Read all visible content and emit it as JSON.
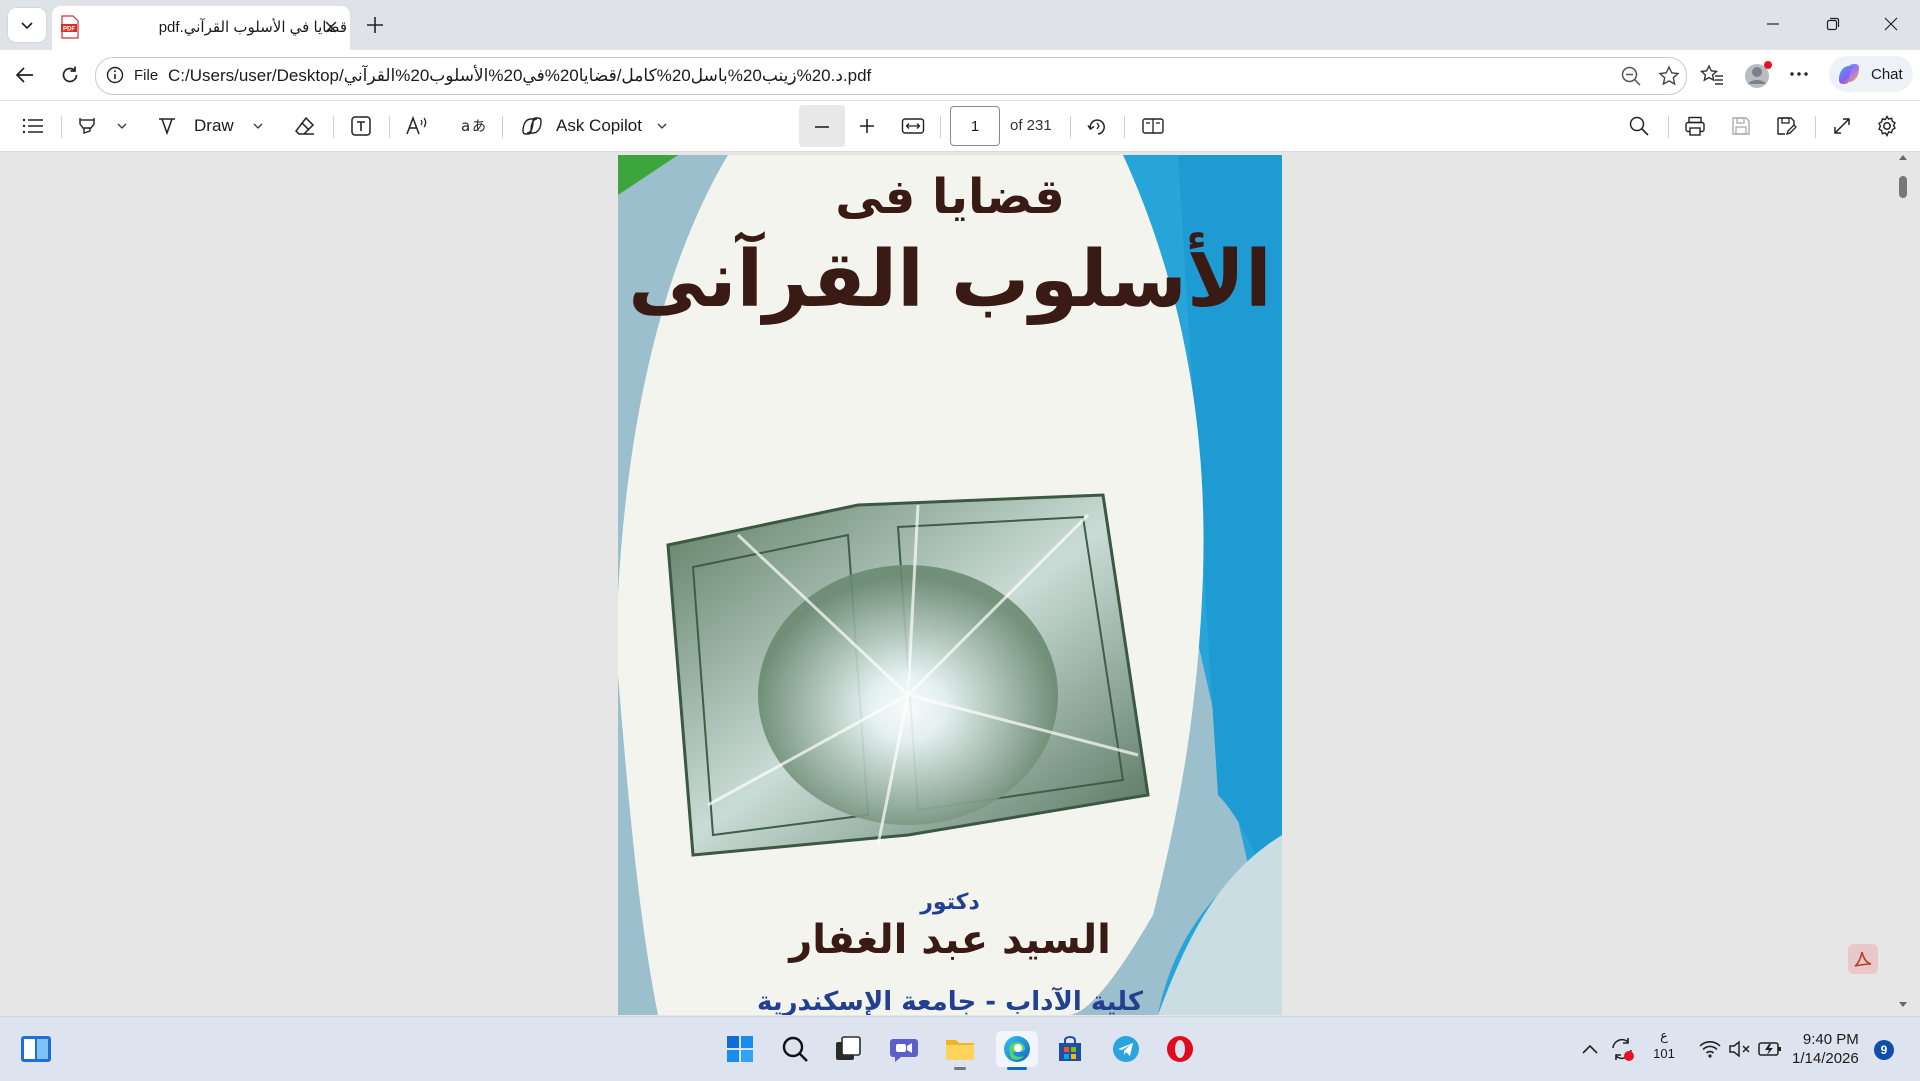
{
  "browser": {
    "tab_title": "قضايا في الأسلوب القرآني.pdf",
    "address_chip": "File",
    "url": "C:/Users/user/Desktop/د.20%زينب20%باسل20%كامل/قضايا20%في20%الأسلوب20%القرآني.pdf",
    "chat_label": "Chat"
  },
  "pdf_toolbar": {
    "draw_label": "Draw",
    "ask_copilot_label": "Ask Copilot",
    "page_current": "1",
    "page_total": "of 231"
  },
  "document": {
    "cover_title_line1": "قضايا فى",
    "cover_title_line2": "الأسلوب القرآنى",
    "author_prefix": "دكتور",
    "author_name": "السيد عبد الغفار",
    "affiliation": "كلية الآداب - جامعة الإسكندرية"
  },
  "taskbar": {
    "lang_line1": "ع",
    "lang_line2": "101",
    "time": "9:40 PM",
    "date": "1/14/2026",
    "notification_count": "9"
  },
  "colors": {
    "accent": "#0f6cbd",
    "cover_blue": "#27a4d8",
    "cover_green": "#3ca53c",
    "title_dark": "#3a1a14",
    "author_blue": "#233f8f"
  }
}
